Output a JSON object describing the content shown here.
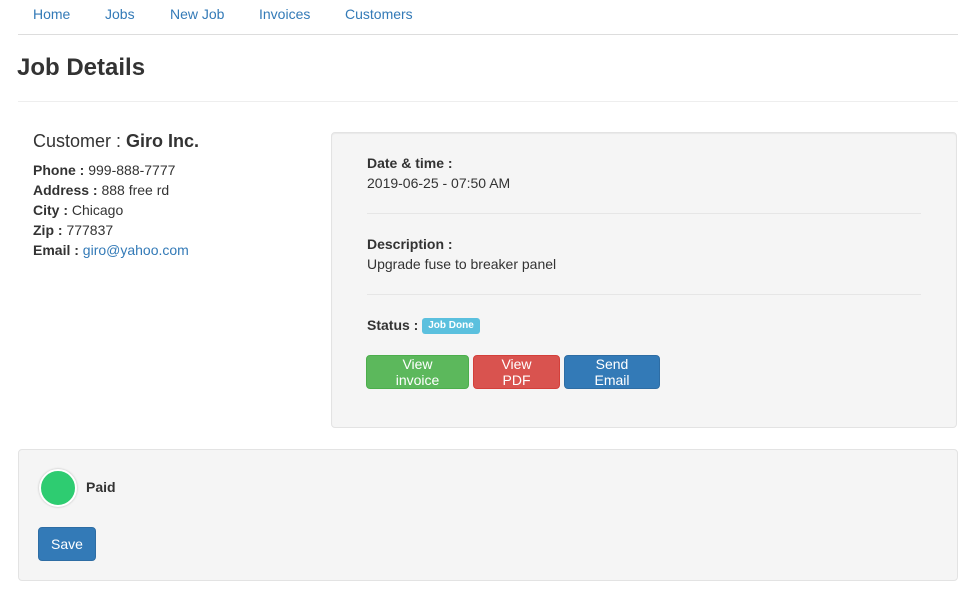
{
  "nav": {
    "items": [
      {
        "label": "Home"
      },
      {
        "label": "Jobs"
      },
      {
        "label": "New Job"
      },
      {
        "label": "Invoices"
      },
      {
        "label": "Customers"
      }
    ]
  },
  "page": {
    "title": "Job Details"
  },
  "customer": {
    "heading_label": "Customer :",
    "name": "Giro Inc.",
    "phone_label": "Phone :",
    "phone": "999-888-7777",
    "address_label": "Address :",
    "address": "888 free rd",
    "city_label": "City :",
    "city": "Chicago",
    "zip_label": "Zip :",
    "zip": "777837",
    "email_label": "Email :",
    "email": "giro@yahoo.com"
  },
  "job": {
    "datetime_label": "Date & time :",
    "datetime": "2019-06-25 - 07:50 AM",
    "description_label": "Description :",
    "description": "Upgrade fuse to breaker panel",
    "status_label": "Status :",
    "status": "Job Done",
    "status_color": "#5bc0de",
    "buttons": {
      "view_invoice": "View invoice",
      "view_pdf": "View PDF",
      "send_email": "Send Email"
    }
  },
  "payment": {
    "paid_label": "Paid",
    "paid_toggle_color": "#2ecc71",
    "save_label": "Save"
  }
}
